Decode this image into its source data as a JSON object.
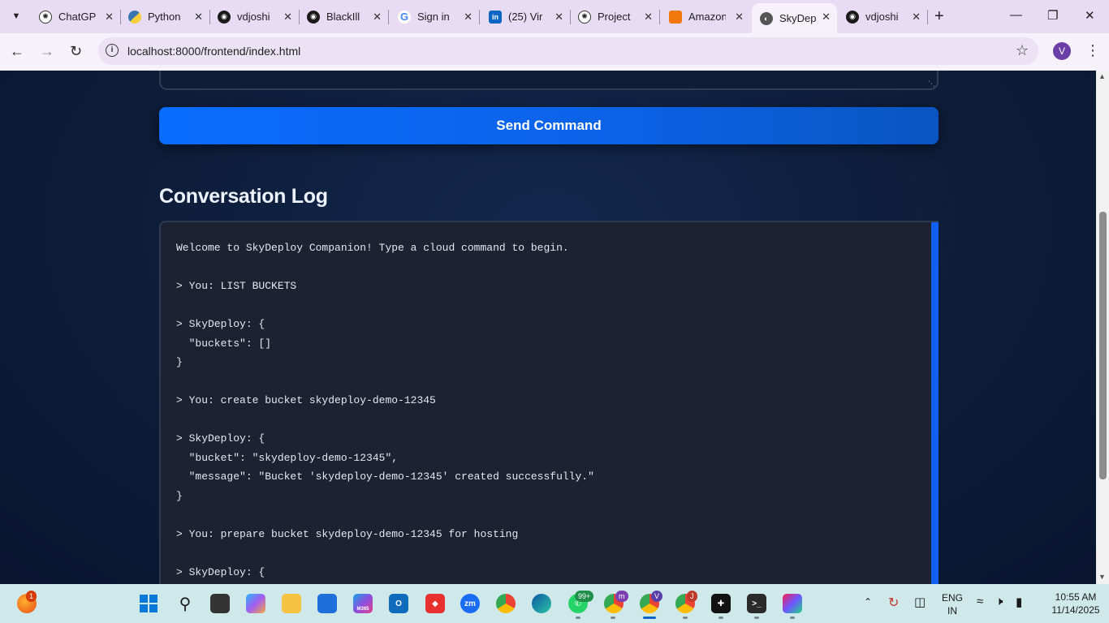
{
  "browser": {
    "tabs": [
      {
        "title": "ChatGPT",
        "icon": "openai-icon",
        "active": false
      },
      {
        "title": "Python",
        "icon": "python-icon",
        "active": false
      },
      {
        "title": "vdjoshi",
        "icon": "github-icon",
        "active": false
      },
      {
        "title": "BlackIll",
        "icon": "github-icon",
        "active": false
      },
      {
        "title": "Sign in",
        "icon": "google-icon",
        "active": false
      },
      {
        "title": "(25) Vir",
        "icon": "linkedin-icon",
        "active": false
      },
      {
        "title": "Project",
        "icon": "openai-icon",
        "active": false
      },
      {
        "title": "Amazon",
        "icon": "aws-icon",
        "active": false
      },
      {
        "title": "SkyDep",
        "icon": "globe-icon",
        "active": true
      },
      {
        "title": "vdjoshi",
        "icon": "github-icon",
        "active": false
      }
    ],
    "url": "localhost:8000/frontend/index.html",
    "profile_initial": "V"
  },
  "page": {
    "send_button": "Send Command",
    "log_title": "Conversation Log",
    "log_lines": [
      "Welcome to SkyDeploy Companion! Type a cloud command to begin.",
      "",
      "> You: LIST BUCKETS",
      "",
      "> SkyDeploy: {",
      "  \"buckets\": []",
      "}",
      "",
      "> You: create bucket skydeploy-demo-12345",
      "",
      "> SkyDeploy: {",
      "  \"bucket\": \"skydeploy-demo-12345\",",
      "  \"message\": \"Bucket 'skydeploy-demo-12345' created successfully.\"",
      "}",
      "",
      "> You: prepare bucket skydeploy-demo-12345 for hosting",
      "",
      "> SkyDeploy: {"
    ]
  },
  "taskbar": {
    "start_badge": "1",
    "whatsapp_badge": "99+",
    "chrome_m_badge": "m",
    "chrome_v_badge": "V",
    "chrome_j_badge": "J",
    "m365_label": "M365",
    "zoom_label": "zm",
    "lang": "ENG",
    "region": "IN",
    "time": "10:55 AM",
    "date": "11/14/2025"
  },
  "colors": {
    "accent": "#0a6cff",
    "page_bg": "#0c1a33",
    "log_bg": "#1c2231",
    "chrome_tabstrip": "#e8dcf4"
  }
}
